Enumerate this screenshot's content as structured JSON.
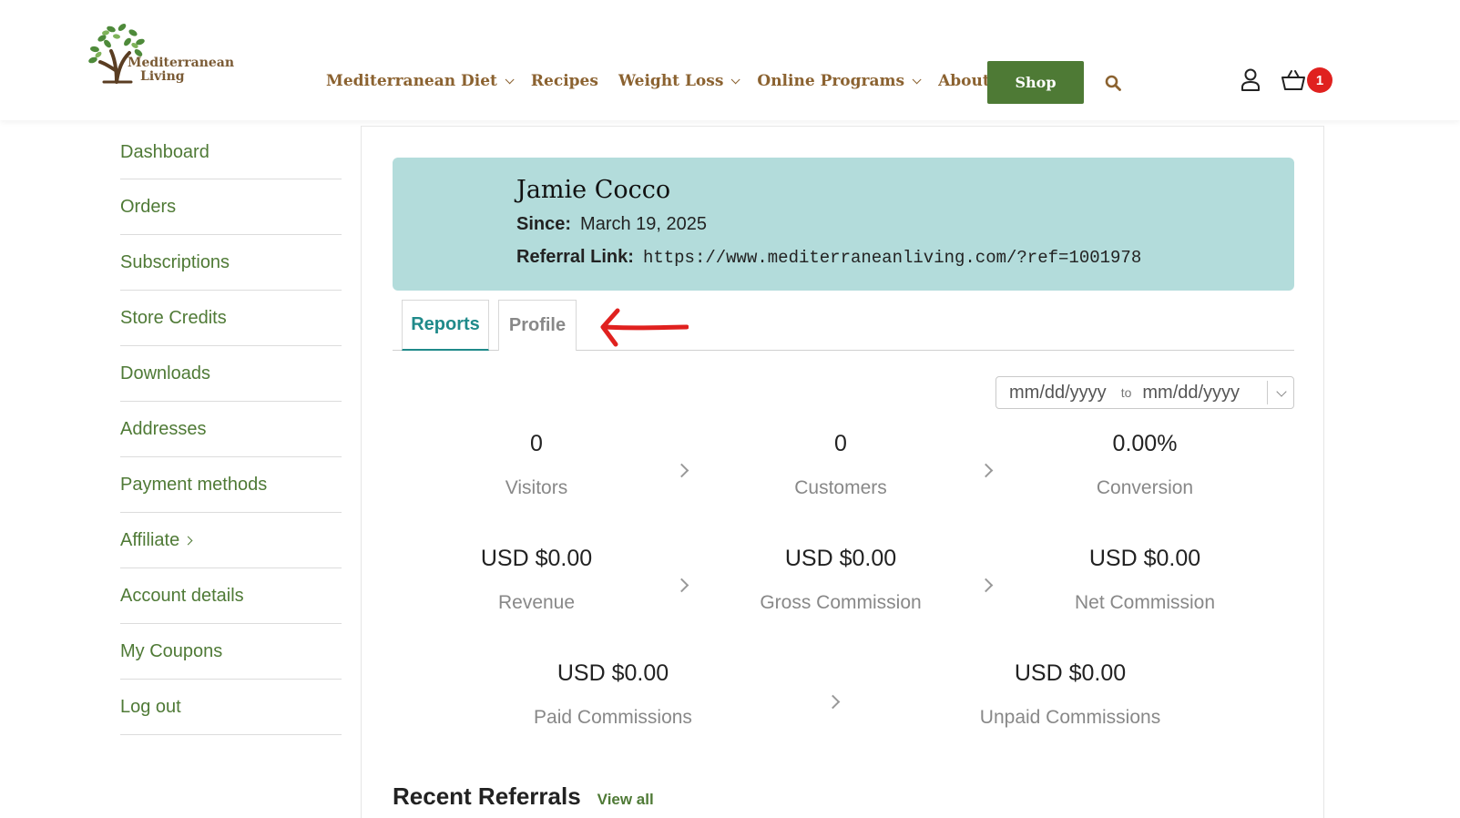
{
  "brand": {
    "name_line1": "Mediterranean",
    "name_line2": "Living",
    "colors": {
      "brand_brown": "#8b6230",
      "brand_green": "#4e7a35",
      "teal": "#1f8a8a",
      "card_bg": "#b3dcdb",
      "badge_red": "#e0211f"
    }
  },
  "nav": {
    "items": [
      {
        "label": "Mediterranean Diet",
        "has_dropdown": true
      },
      {
        "label": "Recipes",
        "has_dropdown": false
      },
      {
        "label": "Weight Loss",
        "has_dropdown": true
      },
      {
        "label": "Online Programs",
        "has_dropdown": true
      },
      {
        "label": "About",
        "has_dropdown": true
      }
    ],
    "shop_label": "Shop",
    "icons": {
      "search": "search-icon",
      "account": "user-icon",
      "cart": "cart-icon"
    },
    "cart_count": "1"
  },
  "sidebar": {
    "items": [
      {
        "label": "Dashboard"
      },
      {
        "label": "Orders"
      },
      {
        "label": "Subscriptions"
      },
      {
        "label": "Store Credits"
      },
      {
        "label": "Downloads"
      },
      {
        "label": "Addresses"
      },
      {
        "label": "Payment methods"
      },
      {
        "label": "Affiliate"
      },
      {
        "label": "Account details"
      },
      {
        "label": "My Coupons"
      },
      {
        "label": "Log out"
      }
    ]
  },
  "profile": {
    "name": "Jamie Cocco",
    "since_label": "Since:",
    "since_value": "March 19, 2025",
    "referral_label": "Referral Link:",
    "referral_value": "https://www.mediterraneanliving.com/?ref=1001978"
  },
  "tabs": [
    {
      "label": "Reports",
      "active": true
    },
    {
      "label": "Profile",
      "active": false
    }
  ],
  "date_range": {
    "from_placeholder": "mm/dd/yyyy",
    "to_label": "to",
    "to_placeholder": "mm/dd/yyyy"
  },
  "stats": {
    "visitors": {
      "value": "0",
      "label": "Visitors"
    },
    "customers": {
      "value": "0",
      "label": "Customers"
    },
    "conversion": {
      "value": "0.00%",
      "label": "Conversion"
    },
    "revenue": {
      "value": "USD $0.00",
      "label": "Revenue"
    },
    "gross_commission": {
      "value": "USD $0.00",
      "label": "Gross Commission"
    },
    "net_commission": {
      "value": "USD $0.00",
      "label": "Net Commission"
    },
    "paid_commissions": {
      "value": "USD $0.00",
      "label": "Paid Commissions"
    },
    "unpaid_commissions": {
      "value": "USD $0.00",
      "label": "Unpaid Commissions"
    }
  },
  "recent": {
    "title": "Recent Referrals",
    "view_all": "View all"
  }
}
